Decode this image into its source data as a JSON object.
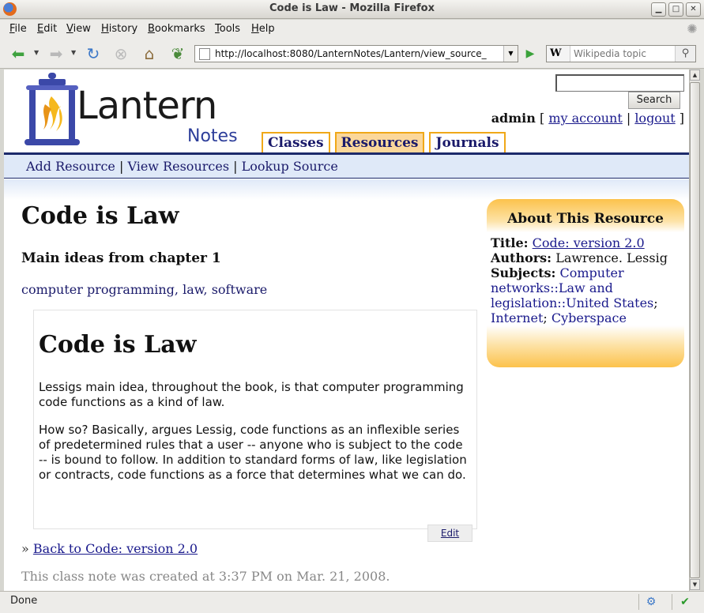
{
  "window": {
    "title": "Code is Law - Mozilla Firefox"
  },
  "menu": {
    "items": [
      {
        "label": "File",
        "access": "F",
        "rest": "ile"
      },
      {
        "label": "Edit",
        "access": "E",
        "rest": "dit"
      },
      {
        "label": "View",
        "access": "V",
        "rest": "iew"
      },
      {
        "label": "History",
        "access": "H",
        "rest": "istory"
      },
      {
        "label": "Bookmarks",
        "access": "B",
        "rest": "ookmarks"
      },
      {
        "label": "Tools",
        "access": "T",
        "rest": "ools"
      },
      {
        "label": "Help",
        "access": "H",
        "rest": "elp"
      }
    ]
  },
  "navbar": {
    "url": "http://localhost:8080/LanternNotes/Lantern/view_source_",
    "search_engine": "W",
    "search_placeholder": "Wikipedia topic"
  },
  "site": {
    "logo_title": "Lantern",
    "logo_subtitle": "Notes",
    "search_button": "Search",
    "user": "admin",
    "my_account": "my account",
    "logout": "logout",
    "tabs": [
      "Classes",
      "Resources",
      "Journals"
    ],
    "active_tab": "Resources",
    "subnav": [
      "Add Resource",
      "View Resources",
      "Lookup Source"
    ]
  },
  "page": {
    "title": "Code is Law",
    "subtitle": "Main ideas from chapter 1",
    "tags": [
      "computer programming",
      "law",
      "software"
    ],
    "note": {
      "heading": "Code is Law",
      "paragraphs": [
        "Lessigs main idea, throughout the book, is that computer programming code functions as a kind of law.",
        "How so? Basically, argues Lessig, code functions as an inflexible series of predetermined rules that a user -- anyone who is subject to the code -- is bound to follow. In addition to standard forms of law, like legislation or contracts, code functions as a force that determines what we can do."
      ],
      "edit_label": "Edit"
    },
    "back_prefix": "»",
    "back_link": "Back to Code: version 2.0",
    "created": "This class note was created at 3:37 PM on Mar. 21, 2008."
  },
  "about": {
    "heading": "About This Resource",
    "title_label": "Title:",
    "title_value": "Code: version 2.0",
    "authors_label": "Authors:",
    "authors_value": "Lawrence. Lessig",
    "subjects_label": "Subjects:",
    "subjects": [
      "Computer networks::Law and legislation::United States",
      "Internet",
      "Cyberspace"
    ]
  },
  "status": {
    "text": "Done"
  }
}
